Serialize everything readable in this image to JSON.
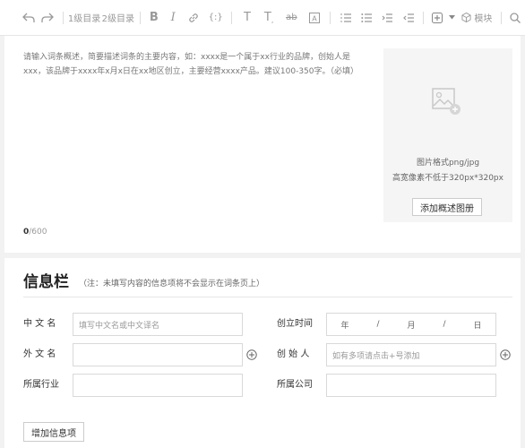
{
  "toolbar": {
    "items": [
      {
        "name": "undo-icon"
      },
      {
        "name": "redo-icon"
      },
      {
        "label": "1级目录"
      },
      {
        "label": "2级目录"
      },
      {
        "name": "bold-icon"
      },
      {
        "name": "italic-icon"
      },
      {
        "name": "link-icon"
      },
      {
        "name": "formula-icon"
      },
      {
        "name": "text-style-icon"
      },
      {
        "name": "subscript-icon"
      },
      {
        "name": "strikethrough-icon"
      },
      {
        "name": "text-box-icon"
      },
      {
        "name": "ordered-list-icon"
      },
      {
        "name": "unordered-list-icon"
      },
      {
        "name": "indent-icon"
      },
      {
        "name": "outdent-icon"
      },
      {
        "name": "insert-icon"
      },
      {
        "name": "dropdown-icon"
      },
      {
        "name": "module-icon",
        "label": "模块"
      },
      {
        "name": "search-icon"
      }
    ]
  },
  "editor": {
    "placeholder": "请输入词条概述，简要描述词条的主要内容，如：xxxx是一个属于xx行业的品牌，创始人是xxx，该品牌于xxxx年x月x日在xx地区创立，主要经营xxxx产品。建议100-350字。（必填）",
    "counter_current": "0",
    "counter_max": "/600",
    "upload": {
      "format_hint": "图片格式png/jpg",
      "size_hint": "高宽像素不低于320px*320px",
      "button": "添加概述图册"
    }
  },
  "info_section": {
    "title": "信息栏",
    "note": "（注：未填写内容的信息项将不会显示在词条页上）",
    "fields": {
      "chinese_name": {
        "label": "中 文 名",
        "placeholder": "填写中文名或中文译名"
      },
      "foreign_name": {
        "label": "外 文 名",
        "placeholder": ""
      },
      "industry": {
        "label": "所属行业",
        "placeholder": ""
      },
      "founded": {
        "label": "创立时间",
        "year": "年",
        "sep1": "/",
        "month": "月",
        "sep2": "/",
        "day": "日"
      },
      "founder": {
        "label": "创 始 人",
        "placeholder": "如有多项请点击+号添加"
      },
      "company": {
        "label": "所属公司",
        "placeholder": ""
      }
    },
    "add_button": "增加信息项"
  },
  "colors": {
    "accent_gray": "#999999",
    "background": "#f2f2f2"
  }
}
